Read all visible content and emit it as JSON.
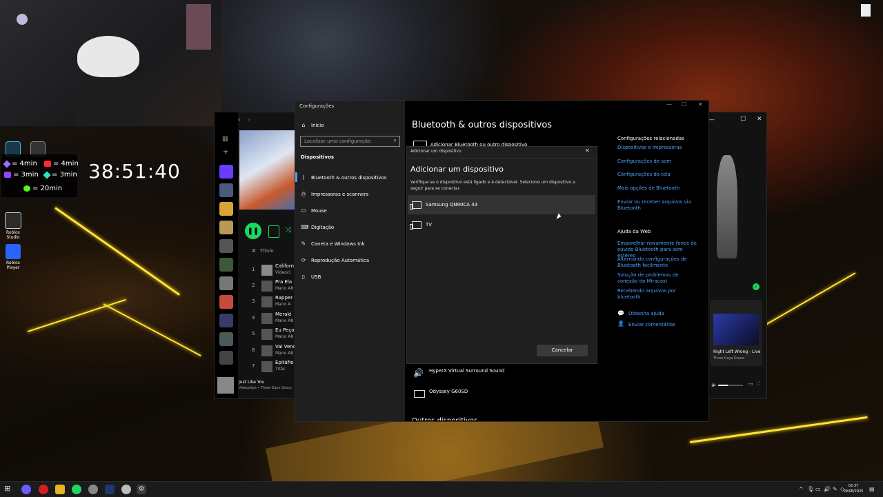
{
  "overlay": {
    "timers": [
      {
        "value": "= 4min",
        "icon": "gem-icon",
        "color": "#a06bff"
      },
      {
        "value": "= 4min",
        "icon": "youtube-icon",
        "color": "#ff2a2a"
      },
      {
        "value": "= 3min",
        "icon": "twitch-icon",
        "color": "#9146ff"
      },
      {
        "value": "= 3min",
        "icon": "diamond-icon",
        "color": "#2fe0c8"
      },
      {
        "value": "= 20min",
        "icon": "kick-icon",
        "color": "#53fc18"
      }
    ],
    "clock": "38:51:40"
  },
  "desktop_icons": [
    {
      "label": "Roblox Studio",
      "icon": "roblox-studio-icon"
    },
    {
      "label": "Roblox Player",
      "icon": "roblox-player-icon"
    }
  ],
  "spotify": {
    "column_header_title": "Título",
    "tracks": [
      {
        "num": "1",
        "title": "Californ",
        "artist": "Videocl"
      },
      {
        "num": "2",
        "title": "Pra Ela",
        "artist": "Mano A8"
      },
      {
        "num": "3",
        "title": "Rapper D",
        "artist": "Mano A"
      },
      {
        "num": "4",
        "title": "Meraki",
        "artist": "Mano A8"
      },
      {
        "num": "5",
        "title": "Eu Peço",
        "artist": "Mano A8"
      },
      {
        "num": "6",
        "title": "Vai Vend",
        "artist": "Mano A8"
      },
      {
        "num": "7",
        "title": "Epitáfio",
        "artist": "Titãs"
      }
    ],
    "now_playing": {
      "title": "Just Like You",
      "subtitle": "Videoclipe • Three Days Grace"
    },
    "queue": {
      "title": "Right Left Wrong - Live",
      "artist": "Three Days Grace"
    }
  },
  "settings": {
    "window_title": "Configurações",
    "home": "Início",
    "search_placeholder": "Localizar uma configuração",
    "section": "Dispositivos",
    "nav": [
      {
        "label": "Bluetooth & outros dispositivos",
        "icon": "bluetooth-icon"
      },
      {
        "label": "Impressoras e scanners",
        "icon": "printer-icon"
      },
      {
        "label": "Mouse",
        "icon": "mouse-icon"
      },
      {
        "label": "Digitação",
        "icon": "keyboard-icon"
      },
      {
        "label": "Caneta e Windows Ink",
        "icon": "pen-icon"
      },
      {
        "label": "Reprodução Automática",
        "icon": "autoplay-icon"
      },
      {
        "label": "USB",
        "icon": "usb-icon"
      }
    ],
    "page_title": "Bluetooth & outros dispositivos",
    "add_button_partial": "Adicionar Bluetooth ou outro dispositivo",
    "related_title": "Configurações relacionadas",
    "related_links": [
      "Dispositivos e impressoras",
      "Configurações de som",
      "Configurações da tela",
      "Mais opções de Bluetooth",
      "Enviar ou receber arquivos via Bluetooth"
    ],
    "help_title": "Ajuda da Web",
    "help_links": [
      "Emparelhar novamente fones de ouvido Bluetooth para som estéreo",
      "Alternando configurações de Bluetooth facilmente",
      "Solução de problemas de conexão do Miracast",
      "Recebendo arquivos por bluetooth"
    ],
    "get_help": "Obtenha ajuda",
    "feedback": "Enviar comentários",
    "devices": [
      {
        "name": "HyperX Virtual Surround Sound",
        "icon": "speaker-icon"
      },
      {
        "name": "Odyssey G60SD",
        "icon": "monitor-icon"
      }
    ],
    "other_devices_partial": "Outros dispositivos"
  },
  "dialog": {
    "titlebar": "Adicionar um dispositivo",
    "heading": "Adicionar um dispositivo",
    "description": "Verifique se o dispositivo está ligado e é detectável. Selecione um dispositivo a seguir para se conectar.",
    "devices": [
      {
        "name": "Samsung QN90CA 43",
        "icon": "display-icon"
      },
      {
        "name": "TV",
        "icon": "display-icon"
      }
    ],
    "cancel": "Cancelar"
  },
  "taskbar": {
    "time": "02:37",
    "date": "09/08/2025"
  }
}
